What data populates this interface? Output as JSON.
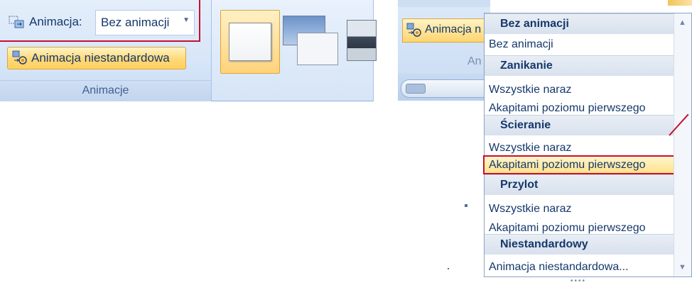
{
  "left_panel": {
    "animation_label": "Animacja:",
    "animation_select_value": "Bez animacji",
    "custom_animation_button": "Animacja niestandardowa",
    "group_label": "Animacje"
  },
  "right_panel": {
    "animation_button_partial": "Animacja n",
    "faded_text": "An"
  },
  "dropdown": {
    "headers": [
      "Bez animacji",
      "Zanikanie",
      "Ścieranie",
      "Przylot",
      "Niestandardowy"
    ],
    "items": [
      "Bez animacji",
      "Wszystkie naraz",
      "Akapitami poziomu pierwszego",
      "Wszystkie naraz",
      "Akapitami poziomu pierwszego",
      "Wszystkie naraz",
      "Akapitami poziomu pierwszego",
      "Animacja niestandardowa..."
    ],
    "highlighted_item_index": 4
  },
  "colors": {
    "highlight_border": "#c8102e",
    "button_gold": "#ffd978",
    "text_blue": "#15386b"
  }
}
